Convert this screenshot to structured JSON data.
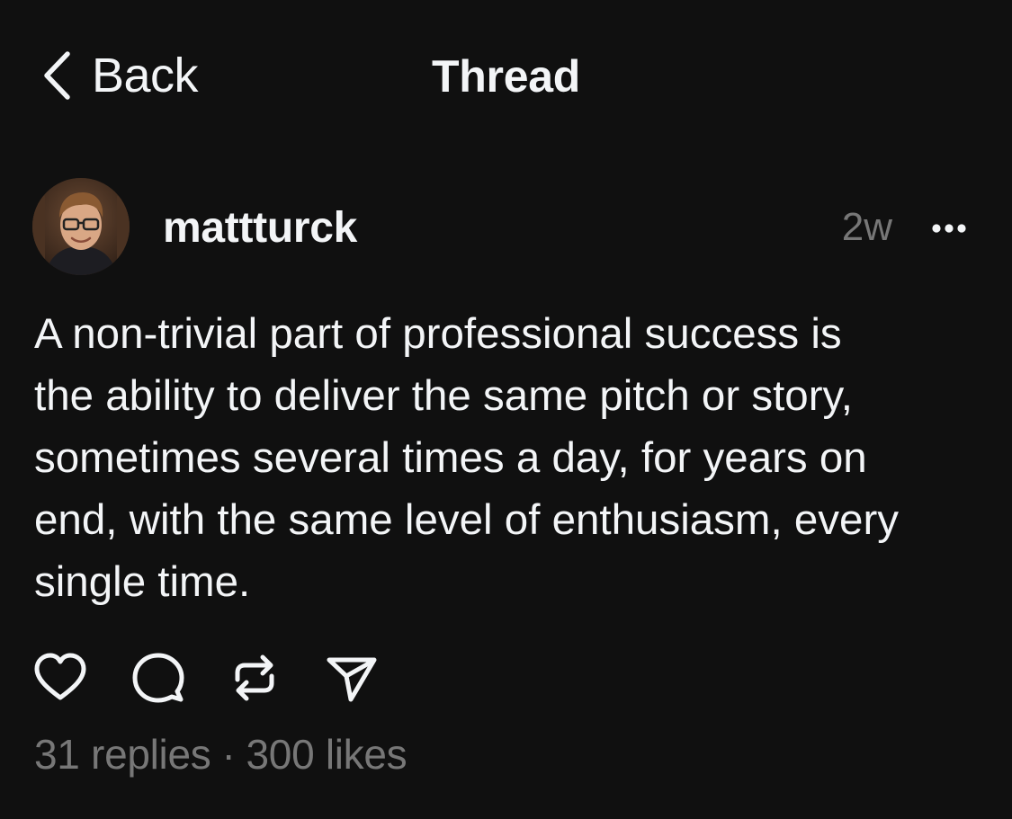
{
  "nav": {
    "back_label": "Back",
    "back_icon": "chevron-left-icon",
    "title": "Thread"
  },
  "post": {
    "username": "mattturck",
    "timestamp": "2w",
    "more_icon": "more-horizontal-icon",
    "text": "A non-trivial part of professional success is\nthe ability to deliver the same pitch or story,\nsometimes several times a day, for years on\nend, with the same level of enthusiasm, every\nsingle time.",
    "actions": [
      {
        "name": "like",
        "icon": "heart-icon"
      },
      {
        "name": "reply",
        "icon": "comment-icon"
      },
      {
        "name": "repost",
        "icon": "repost-icon"
      },
      {
        "name": "share",
        "icon": "send-icon"
      }
    ],
    "replies": "31 replies",
    "separator": "·",
    "likes": "300 likes"
  },
  "colors": {
    "background": "#101010",
    "text": "#f3f5f7",
    "muted": "#777777"
  }
}
